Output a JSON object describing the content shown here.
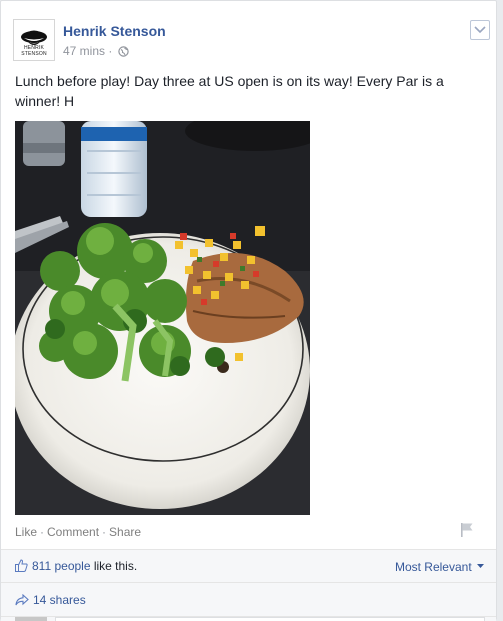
{
  "post": {
    "author": "Henrik Stenson",
    "avatar_logo_text": "HENRIK STENSON",
    "time": "47 mins",
    "separator": "·",
    "text": "Lunch before play! Day three at US open is on its way! Every Par is a winner! H"
  },
  "actions": {
    "like": "Like",
    "comment": "Comment",
    "share": "Share",
    "dot": "·"
  },
  "likes": {
    "count": "811 people",
    "suffix": " like this.",
    "sort_label": "Most Relevant"
  },
  "shares": {
    "label": "14 shares"
  },
  "icons": {
    "globe": "globe-icon",
    "chevron": "chevron-down-icon",
    "flag": "flag-icon",
    "thumb": "thumbs-up-icon",
    "share": "share-arrow-icon"
  },
  "colors": {
    "link": "#365899",
    "muted": "#90949c",
    "bar": "#f6f7f9"
  }
}
